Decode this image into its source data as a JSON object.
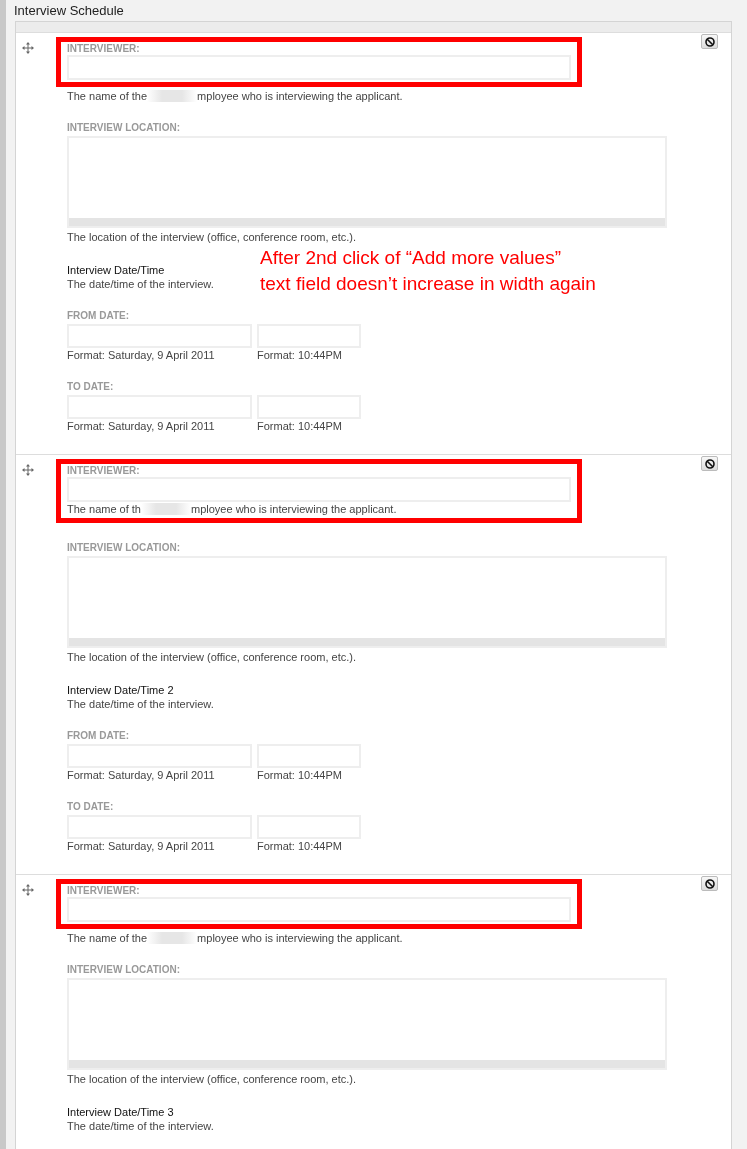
{
  "section_title": "Interview Schedule",
  "groups": [
    {
      "highlighted": true,
      "highlight_covers_description": false,
      "interviewer": {
        "label": "INTERVIEWER:",
        "description_before": "The name of the",
        "description_after": "mployee who is interviewing the applicant."
      },
      "location": {
        "label": "INTERVIEW LOCATION:",
        "description": "The location of the interview (office, conference room, etc.)."
      },
      "datetime": {
        "title": "Interview Date/Time",
        "description": "The date/time of the interview.",
        "ranges": [
          {
            "label": "FROM DATE:",
            "date_format": "Format: Saturday, 9 April 2011",
            "time_format": "Format: 10:44PM"
          },
          {
            "label": "TO DATE:",
            "date_format": "Format: Saturday, 9 April 2011",
            "time_format": "Format: 10:44PM"
          }
        ]
      },
      "annotation": [
        "After 2nd click of “Add more values”",
        "text field doesn’t increase in width again"
      ]
    },
    {
      "highlighted": true,
      "highlight_covers_description": true,
      "interviewer": {
        "label": "INTERVIEWER:",
        "description_before": "The name of th",
        "description_after": "mployee who is interviewing the applicant."
      },
      "location": {
        "label": "INTERVIEW LOCATION:",
        "description": "The location of the interview (office, conference room, etc.)."
      },
      "datetime": {
        "title": "Interview Date/Time 2",
        "description": "The date/time of the interview.",
        "ranges": [
          {
            "label": "FROM DATE:",
            "date_format": "Format: Saturday, 9 April 2011",
            "time_format": "Format: 10:44PM"
          },
          {
            "label": "TO DATE:",
            "date_format": "Format: Saturday, 9 April 2011",
            "time_format": "Format: 10:44PM"
          }
        ]
      }
    },
    {
      "highlighted": true,
      "highlight_covers_description": false,
      "interviewer": {
        "label": "INTERVIEWER:",
        "description_before": "The name of the",
        "description_after": "mployee who is interviewing the applicant."
      },
      "location": {
        "label": "INTERVIEW LOCATION:",
        "description": "The location of the interview (office, conference room, etc.)."
      },
      "datetime": {
        "title": "Interview Date/Time 3",
        "description": "The date/time of the interview."
      }
    }
  ]
}
